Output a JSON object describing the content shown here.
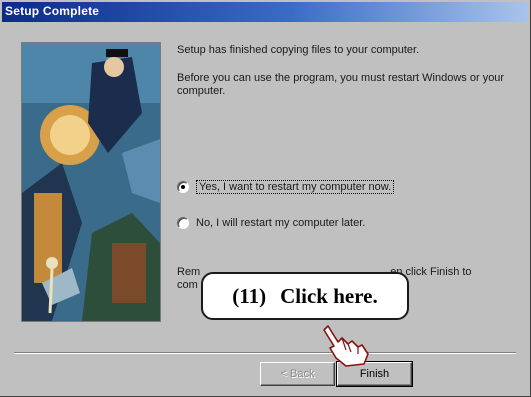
{
  "window": {
    "title": "Setup Complete"
  },
  "message": {
    "line1": "Setup has finished copying files to your computer.",
    "line2": "Before you can use the program, you must restart Windows or your computer."
  },
  "options": [
    {
      "label": "Yes, I want to restart my computer now.",
      "selected": true
    },
    {
      "label": "No, I will restart my computer later.",
      "selected": false
    }
  ],
  "footer_text": {
    "left": "Rem",
    "left2": "com",
    "right": "en click Finish to"
  },
  "callout": {
    "number": "(11)",
    "text": "Click here."
  },
  "buttons": {
    "back": "< Back",
    "finish": "Finish"
  },
  "icons": {
    "pointer": "pointing-hand-icon"
  },
  "colors": {
    "title_start": "#0c2a8a",
    "title_end": "#a9c4ea",
    "face": "#c0c0c0"
  }
}
